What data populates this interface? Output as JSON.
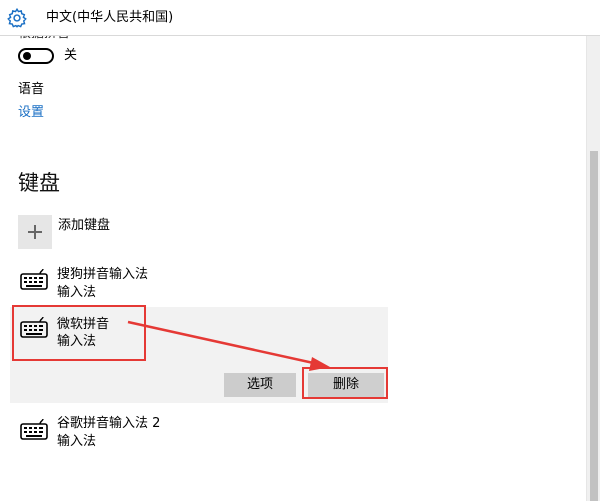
{
  "window": {
    "title": "中文(中华人民共和国)",
    "settings_icon": "gear-icon"
  },
  "partial": {
    "heading_fragment": "根据拼音"
  },
  "toggle": {
    "state_label": "关",
    "on": false
  },
  "language": {
    "label": "语音",
    "settings_link": "设置"
  },
  "keyboards": {
    "section_title": "键盘",
    "add_label": "添加键盘",
    "add_icon": "plus-icon",
    "items": [
      {
        "name": "搜狗拼音输入法",
        "type": "输入法",
        "icon": "keyboard-icon"
      },
      {
        "name": "微软拼音",
        "type": "输入法",
        "icon": "keyboard-icon",
        "selected": true
      },
      {
        "name": "谷歌拼音输入法 2",
        "type": "输入法",
        "icon": "keyboard-icon"
      }
    ],
    "options_button": "选项",
    "delete_button": "删除"
  },
  "colors": {
    "accent_link": "#1a6fc4",
    "annotation_red": "#e53935"
  }
}
